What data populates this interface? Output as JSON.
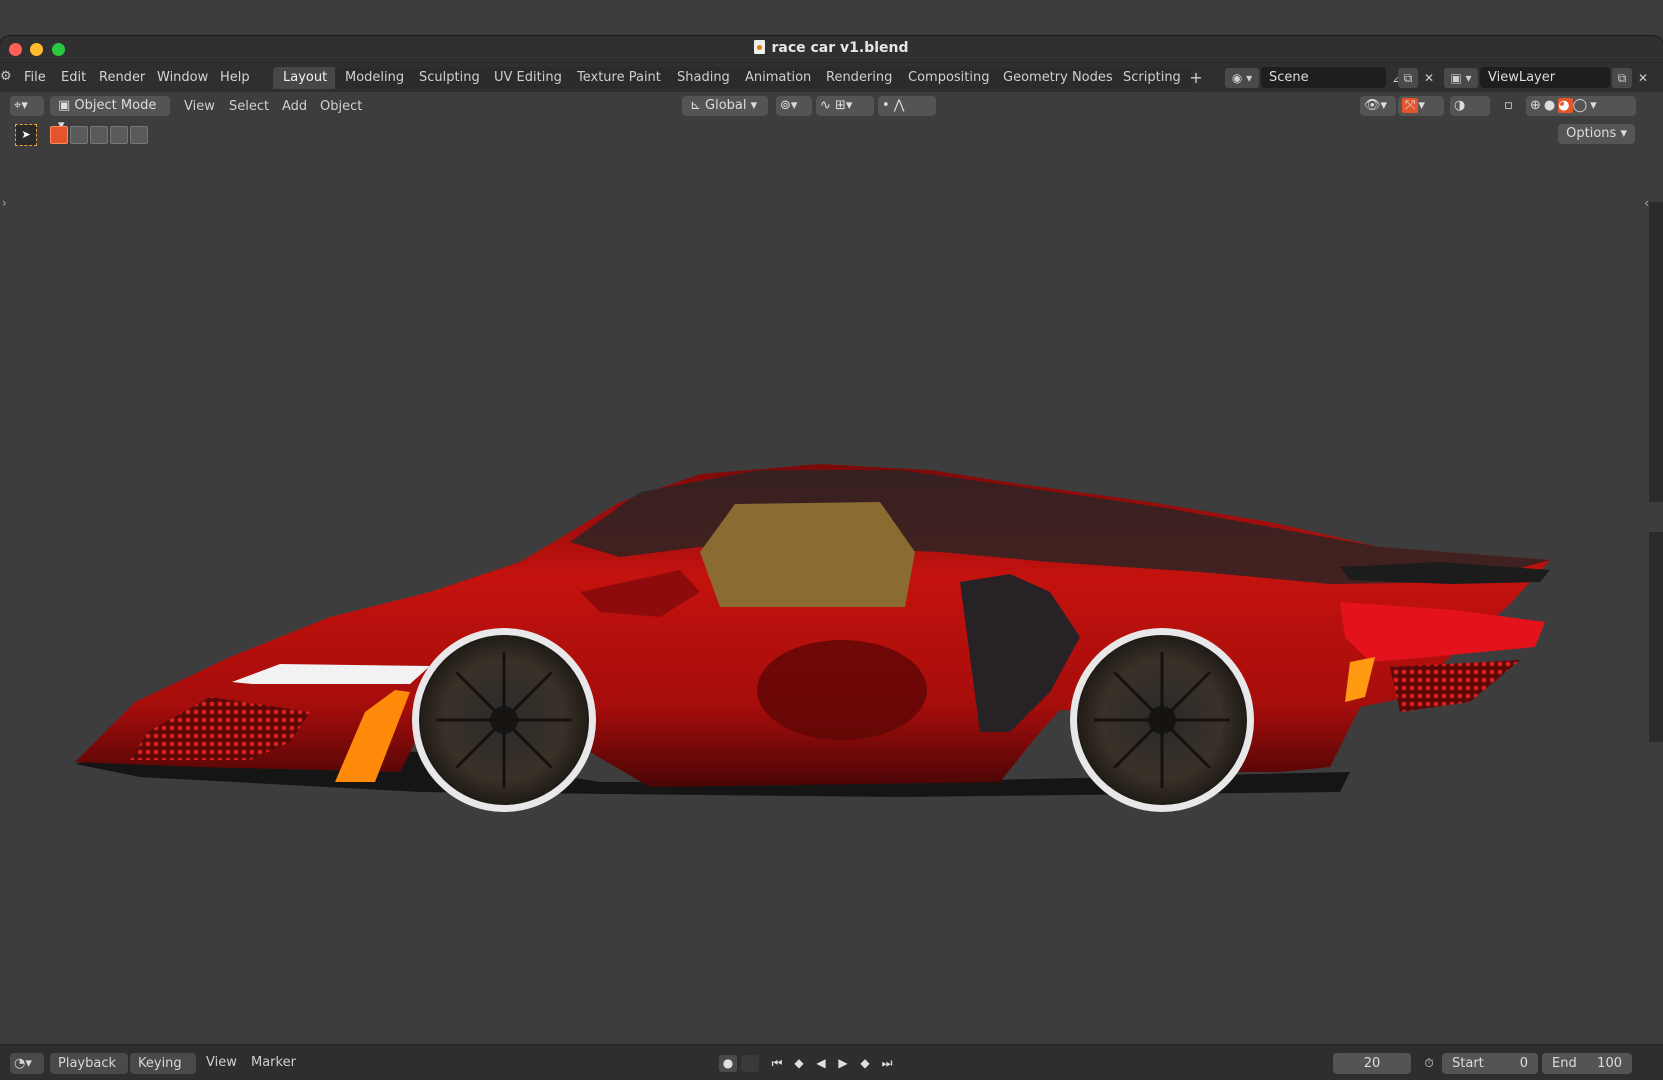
{
  "window": {
    "title": "race car v1.blend"
  },
  "menubar": {
    "menus": [
      "File",
      "Edit",
      "Render",
      "Window",
      "Help"
    ],
    "workspace_tabs": [
      "Layout",
      "Modeling",
      "Sculpting",
      "UV Editing",
      "Texture Paint",
      "Shading",
      "Animation",
      "Rendering",
      "Compositing",
      "Geometry Nodes",
      "Scripting"
    ],
    "active_tab": "Layout",
    "scene": "Scene",
    "view_layer": "ViewLayer"
  },
  "viewport_header": {
    "mode": "Object Mode",
    "menus": [
      "View",
      "Select",
      "Add",
      "Object"
    ],
    "transform_orientation": "Global",
    "options_label": "Options"
  },
  "timeline": {
    "playback_label": "Playback",
    "keying_label": "Keying",
    "view_label": "View",
    "marker_label": "Marker",
    "current_frame": "20",
    "start_label": "Start",
    "start_value": "0",
    "end_label": "End",
    "end_value": "100"
  },
  "colors": {
    "accent_orange": "#e4552d",
    "viewport_bg": "#3d3d3d",
    "car_body": "#b30d0d"
  }
}
